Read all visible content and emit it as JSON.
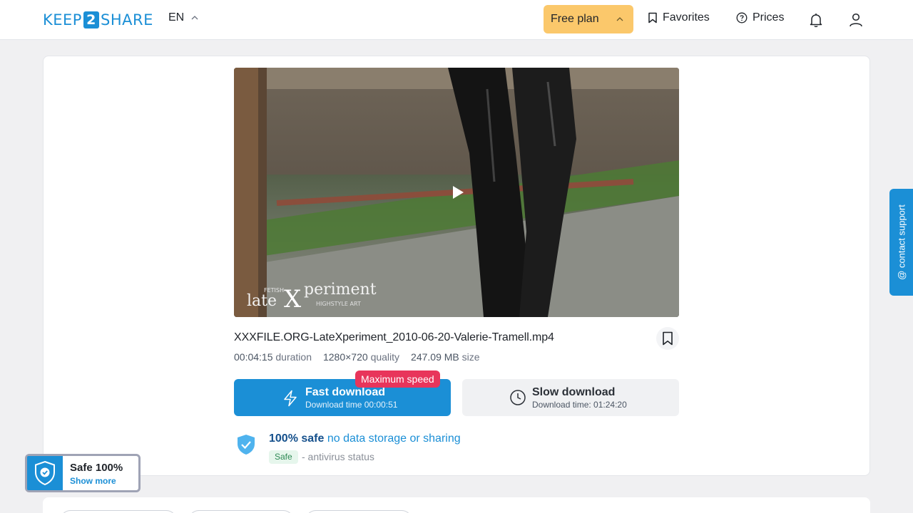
{
  "header": {
    "logo_left": "KEEP",
    "logo_num": "2",
    "logo_right": "SHARE",
    "lang": "EN",
    "plan_label": "Free plan",
    "favorites_label": "Favorites",
    "prices_label": "Prices"
  },
  "file": {
    "name": "XXXFILE.ORG-LateXperiment_2010-06-20-Valerie-Tramell.mp4",
    "duration_value": "00:04:15",
    "duration_label": "duration",
    "quality_value": "1280×720",
    "quality_label": "quality",
    "size_value": "247.09 MB",
    "size_label": "size"
  },
  "preview": {
    "watermark_small": "FETISH",
    "watermark_main_a": "late",
    "watermark_main_x": "X",
    "watermark_main_b": "periment",
    "watermark_sub": "HIGHSTYLE ART"
  },
  "download": {
    "badge": "Maximum speed",
    "fast_title": "Fast download",
    "fast_sub": "Download time 00:00:51",
    "slow_title": "Slow download",
    "slow_sub": "Download time: 01:24:20"
  },
  "safety": {
    "strong": "100% safe",
    "rest": " no data storage or sharing",
    "pill": "Safe",
    "status": "- antivirus status"
  },
  "support": {
    "label": "@ contact support"
  },
  "safe_widget": {
    "title": "Safe 100%",
    "link": "Show more"
  },
  "colors": {
    "accent": "#1b8fd6",
    "plan": "#fbc86b",
    "badge": "#e8355b"
  }
}
